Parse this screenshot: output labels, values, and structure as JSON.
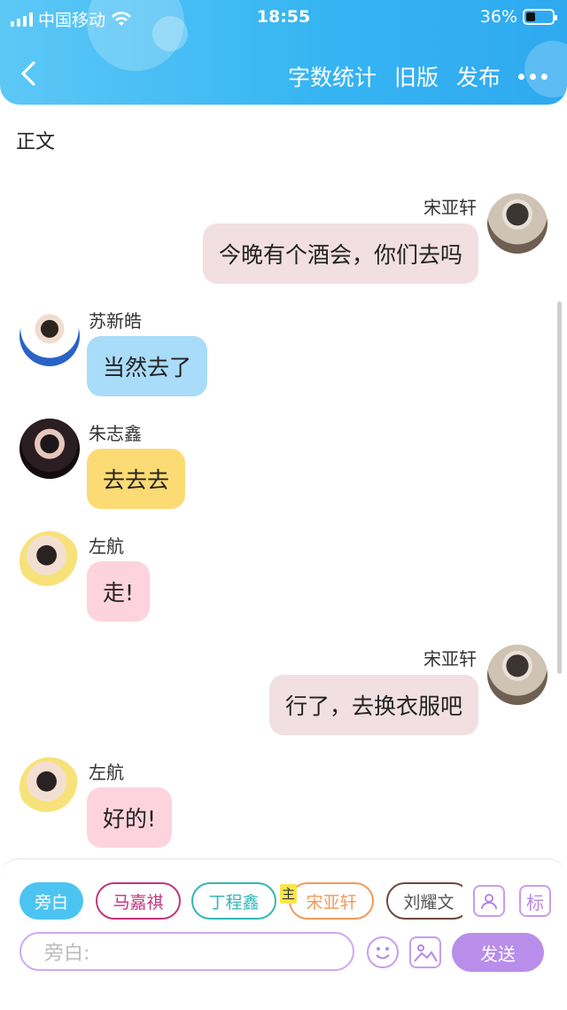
{
  "status_bar": {
    "carrier": "中国移动",
    "time": "18:55",
    "battery": "36%"
  },
  "nav": {
    "actions": [
      "字数统计",
      "旧版",
      "发布"
    ]
  },
  "section_label": "正文",
  "messages": [
    {
      "side": "right",
      "name": "宋亚轩",
      "text": "今晚有个酒会，你们去吗",
      "color": "#f1dfe2"
    },
    {
      "side": "left",
      "name": "苏新皓",
      "text": "当然去了",
      "color": "#a9dcf9"
    },
    {
      "side": "left",
      "name": "朱志鑫",
      "text": "去去去",
      "color": "#fcdb74"
    },
    {
      "side": "left",
      "name": "左航",
      "text": "走!",
      "color": "#fdd3dd"
    },
    {
      "side": "right",
      "name": "宋亚轩",
      "text": "行了，去换衣服吧",
      "color": "#f1dfe2"
    },
    {
      "side": "left",
      "name": "左航",
      "text": "好的!",
      "color": "#fdd3dd"
    }
  ],
  "composer": {
    "chips": [
      {
        "label": "旁白",
        "active": true,
        "color": "#4cc4f2"
      },
      {
        "label": "马嘉祺",
        "active": false,
        "color": "#c2357e"
      },
      {
        "label": "丁程鑫",
        "active": false,
        "color": "#35b6b6"
      },
      {
        "label": "宋亚轩",
        "active": false,
        "color": "#f29a5b"
      },
      {
        "label": "刘耀文",
        "active": false,
        "color": "#6b4a3f"
      }
    ],
    "host_tag": "主",
    "tag_button": "标",
    "placeholder": "旁白:",
    "send_label": "发送"
  },
  "colors": {
    "header_start": "#5cc8f6",
    "header_end": "#2ea9f0",
    "send": "#b98eea"
  }
}
